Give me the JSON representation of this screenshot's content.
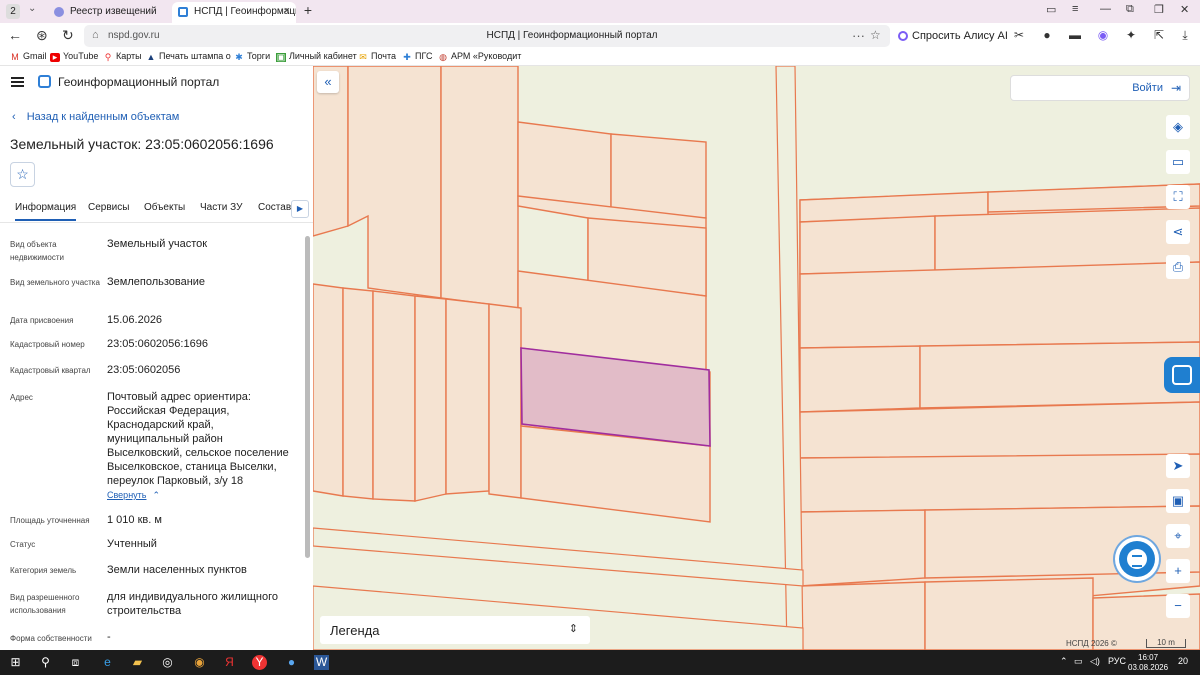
{
  "browser": {
    "tab_count": "2",
    "tabs": [
      {
        "title": "Реестр извещений",
        "active": false
      },
      {
        "title": "НСПД | Геоинформаци",
        "active": true
      }
    ],
    "url": "nspd.gov.ru",
    "page_title": "НСПД | Геоинформационный портал",
    "alice_label": "Спросить Алису AI",
    "bookmarks": [
      "Gmail",
      "YouTube",
      "Карты",
      "Печать штампа о",
      "Торги",
      "Личный кабинет",
      "Почта",
      "ПГС",
      "АРМ «Руководит"
    ]
  },
  "panel": {
    "portal_title": "Геоинформационный портал",
    "back_label": "Назад к найденным объектам",
    "title": "Земельный участок: 23:05:0602056:1696",
    "tabs": [
      "Информация",
      "Сервисы",
      "Объекты",
      "Части ЗУ",
      "Состав"
    ],
    "fields": [
      {
        "label": "Вид объекта недвижимости",
        "value": "Земельный участок"
      },
      {
        "label": "Вид земельного участка",
        "value": "Землепользование"
      },
      {
        "label": "Дата присвоения",
        "value": "15.06.2026"
      },
      {
        "label": "Кадастровый номер",
        "value": "23:05:0602056:1696"
      },
      {
        "label": "Кадастровый квартал",
        "value": "23:05:0602056"
      },
      {
        "label": "Адрес",
        "value": "Почтовый адрес ориентира: Российская Федерация, Краснодарский край, муниципальный район Выселковский, сельское поселение Выселковское, станица Выселки, переулок Парковый, з/у 18"
      },
      {
        "label": "Площадь уточненная",
        "value": "1 010 кв. м"
      },
      {
        "label": "Статус",
        "value": "Учтенный"
      },
      {
        "label": "Категория земель",
        "value": "Земли населенных пунктов"
      },
      {
        "label": "Вид разрешенного использования",
        "value": "для индивидуального жилищного строительства"
      },
      {
        "label": "Форма собственности",
        "value": "-"
      }
    ],
    "collapse_label": "Свернуть"
  },
  "map": {
    "login_label": "Войти",
    "legend_label": "Легенда",
    "attribution": "НСПД 2026 ©",
    "scale_label": "10 m",
    "colors": {
      "parcel_fill": "#f5e3d2",
      "parcel_stroke": "#e8794f",
      "selected_fill": "#e2bcc8",
      "selected_stroke": "#a02d9e",
      "road_fill": "#eef0df",
      "accent": "#1f7fd0"
    }
  },
  "taskbar": {
    "lang": "РУС",
    "time": "16:07",
    "date": "03.08.2026",
    "notifications": "20"
  }
}
